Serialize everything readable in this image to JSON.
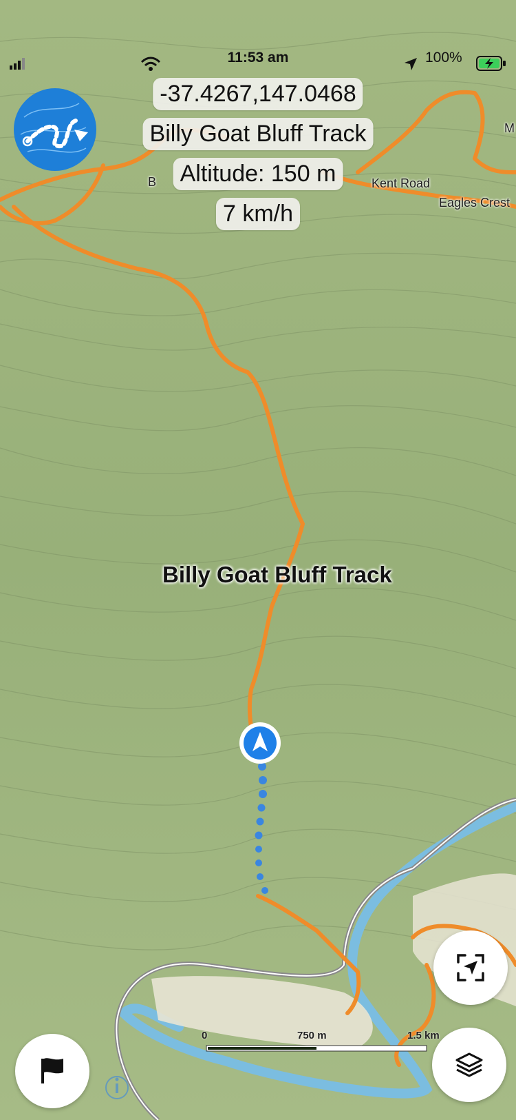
{
  "status_bar": {
    "time": "11:53 am",
    "battery": "100%"
  },
  "info": {
    "coordinates": "-37.4267,147.0468",
    "track_name": "Billy Goat Bluff Track",
    "altitude": "Altitude: 150 m",
    "speed": "7 km/h"
  },
  "map": {
    "track_label": "Billy Goat Bluff Track",
    "road_labels": [
      "Kent Road",
      "Eagles Crest",
      "M",
      "B"
    ],
    "scale": {
      "start": "0",
      "mid": "750 m",
      "end": "1.5 km"
    }
  },
  "icons": {
    "app_logo": "topo-route-logo-icon",
    "user_location": "navigation-arrow-icon",
    "recenter": "locate-crosshair-icon",
    "flag": "flag-icon",
    "layers": "layers-icon",
    "info": "info-icon"
  },
  "colors": {
    "terrain": "#9fb57e",
    "track": "#ef8c2a",
    "river": "#7bbde0",
    "road": "#8a8a8a",
    "location": "#1f80e8"
  }
}
